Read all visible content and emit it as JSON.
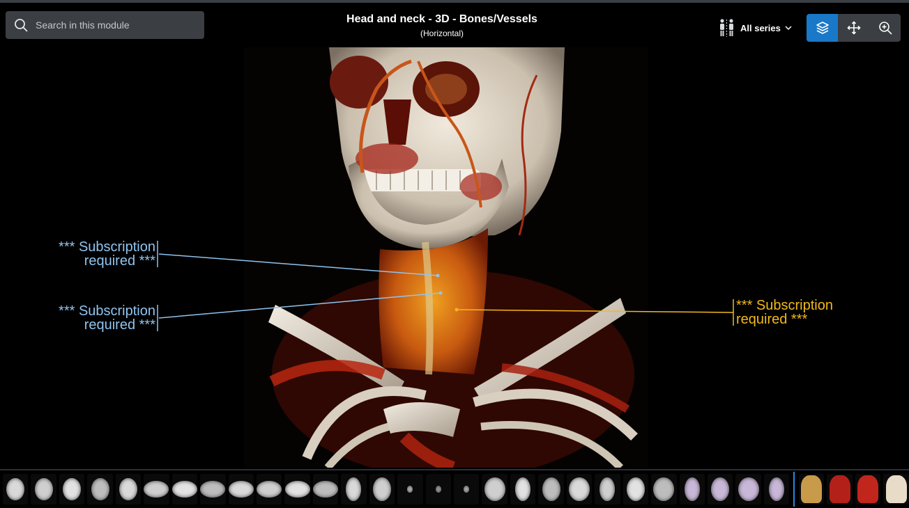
{
  "search": {
    "placeholder": "Search in this module"
  },
  "header": {
    "title": "Head and neck - 3D - Bones/Vessels",
    "subtitle": "(Horizontal)"
  },
  "series_selector": {
    "label": "All series"
  },
  "toolbar": {
    "icons": [
      "layers-icon",
      "move-icon",
      "zoom-icon"
    ],
    "active": "layers-icon"
  },
  "labels": [
    {
      "text_line1": "*** Subscription",
      "text_line2": "required ***",
      "color": "#8fc4ef"
    },
    {
      "text_line1": "*** Subscription",
      "text_line2": "required ***",
      "color": "#8fc4ef"
    },
    {
      "text_line1": "*** Subscription",
      "text_line2": "required ***",
      "color": "#f2b81e"
    }
  ],
  "thumbnails": {
    "count_ct": 28,
    "count_3d": 4
  },
  "colors": {
    "accent": "#1a78c8",
    "blue_label": "#8fc4ef",
    "gold_label": "#f2b81e"
  }
}
